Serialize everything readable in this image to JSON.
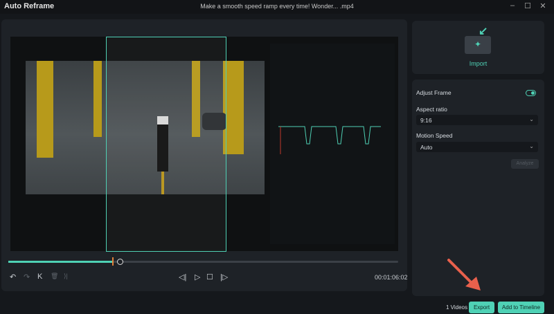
{
  "window": {
    "app_title": "Auto Reframe",
    "file_title": "Make a smooth speed ramp every time!  Wonder... .mp4",
    "minimize": "–",
    "maximize": "☐",
    "close": "✕"
  },
  "player": {
    "timecode": "00:01:06:02",
    "progress_percent": 27,
    "controls": {
      "undo": "↶",
      "redo": "↷",
      "to_start": "K",
      "delete": "🗑",
      "to_end": "⟩|",
      "prev_frame": "◁|",
      "play": "▷",
      "stop": "☐",
      "next_frame": "|▷"
    }
  },
  "import": {
    "label": "Import"
  },
  "settings": {
    "adjust_frame": "Adjust Frame",
    "adjust_frame_on": true,
    "aspect_ratio_label": "Aspect ratio",
    "aspect_ratio": "9:16",
    "motion_speed_label": "Motion Speed",
    "motion_speed": "Auto",
    "analyze": "Analyze"
  },
  "footer": {
    "videos_count": "1 Videos",
    "export": "Export",
    "add_to_timeline": "Add to Timeline"
  },
  "colors": {
    "accent": "#4fd1b5",
    "annotation_arrow": "#e8604c"
  }
}
